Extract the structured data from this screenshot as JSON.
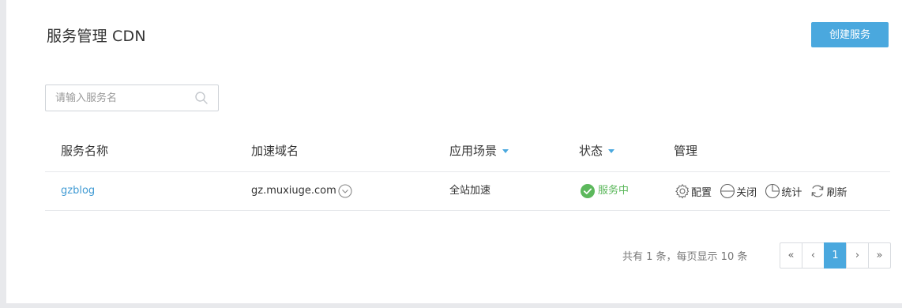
{
  "header": {
    "title": "服务管理 CDN",
    "create_button": "创建服务"
  },
  "search": {
    "placeholder": "请输入服务名"
  },
  "table": {
    "columns": [
      "服务名称",
      "加速域名",
      "应用场景",
      "状态",
      "管理"
    ],
    "rows": [
      {
        "service_name": "gzblog",
        "domain": "gz.muxiuge.com",
        "scenario": "全站加速",
        "status": "服务中",
        "actions": [
          "配置",
          "关闭",
          "统计",
          "刷新"
        ]
      }
    ]
  },
  "pagination": {
    "summary": "共有 1 条，每页显示 10 条",
    "first": "«",
    "prev": "‹",
    "current": "1",
    "next": "›",
    "last": "»"
  },
  "colors": {
    "accent": "#4aa8de",
    "link": "#3f9ad3",
    "status_ok": "#5cb85c"
  },
  "icons": {
    "search": "search-icon",
    "domain_toggle": "chevron-down-circle-icon",
    "status": "check-circle-icon",
    "config": "gear-icon",
    "close": "minus-circle-icon",
    "stats": "pie-chart-icon",
    "refresh": "refresh-icon"
  }
}
